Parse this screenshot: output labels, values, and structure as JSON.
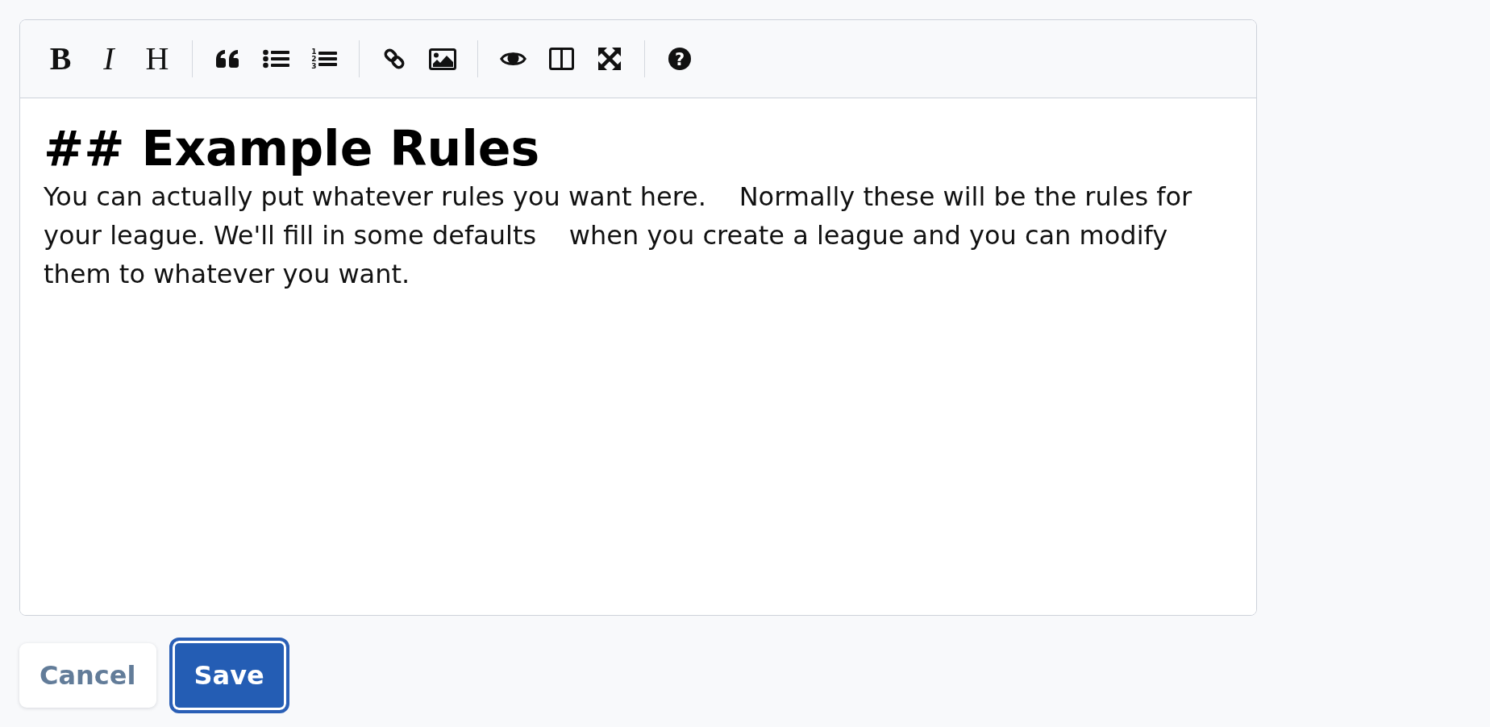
{
  "editor": {
    "toolbar": {
      "groups": [
        {
          "items": [
            {
              "kind": "bold",
              "glyph": "B"
            },
            {
              "kind": "italic",
              "glyph": "I"
            },
            {
              "kind": "heading",
              "glyph": "H"
            }
          ]
        },
        {
          "items": [
            {
              "kind": "quote"
            },
            {
              "kind": "unordered-list"
            },
            {
              "kind": "ordered-list",
              "numerals": [
                "1",
                "2",
                "3"
              ]
            }
          ]
        },
        {
          "items": [
            {
              "kind": "link"
            },
            {
              "kind": "image"
            }
          ]
        },
        {
          "items": [
            {
              "kind": "preview"
            },
            {
              "kind": "side-by-side"
            },
            {
              "kind": "fullscreen"
            }
          ]
        },
        {
          "items": [
            {
              "kind": "help",
              "glyph": "?"
            }
          ]
        }
      ]
    },
    "content": [
      {
        "kind": "heading",
        "text": "## Example Rules"
      },
      {
        "kind": "paragraph",
        "text": "You can actually put whatever rules you want here.    Normally these will be the rules for your league. We'll fill in some defaults    when you create a league and you can modify them to whatever you want."
      }
    ]
  },
  "buttons": [
    {
      "label": "Cancel",
      "kind": "secondary",
      "focused": false
    },
    {
      "label": "Save",
      "kind": "primary",
      "focused": true
    }
  ]
}
